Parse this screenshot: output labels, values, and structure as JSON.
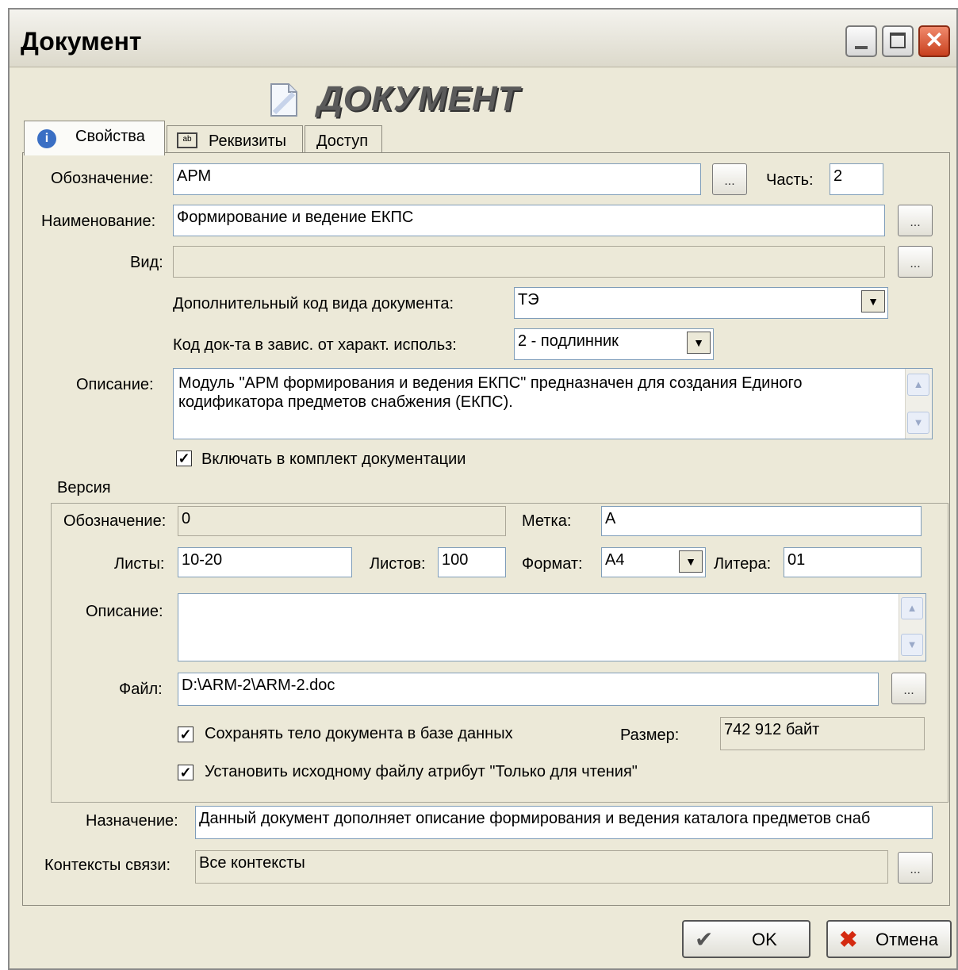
{
  "window": {
    "title": "Документ",
    "header_title": "ДОКУМЕНТ"
  },
  "tabs": [
    {
      "label": "Свойства",
      "icon": "info-icon"
    },
    {
      "label": "Реквизиты",
      "icon": "fields-icon"
    },
    {
      "label": "Доступ"
    }
  ],
  "props": {
    "designation_label": "Обозначение:",
    "designation_value": "АРМ",
    "part_label": "Часть:",
    "part_value": "2",
    "name_label": "Наименование:",
    "name_value": "Формирование и ведение ЕКПС",
    "kind_label": "Вид:",
    "kind_value": "",
    "extra_code_label": "Дополнительный код вида документа:",
    "extra_code_value": "ТЭ",
    "usage_code_label": "Код док-та в завис. от характ. использ:",
    "usage_code_value": "2 - подлинник",
    "description_label": "Описание:",
    "description_value": "Модуль \"АРМ формирования и ведения ЕКПС\" предназначен для создания Единого кодификатора предметов снабжения (ЕКПС).",
    "include_label": "Включать в комплект документации",
    "include_checked": true
  },
  "version": {
    "group_label": "Версия",
    "designation_label": "Обозначение:",
    "designation_value": "0",
    "mark_label": "Метка:",
    "mark_value": "А",
    "sheets_label": "Листы:",
    "sheets_value": "10-20",
    "sheets_count_label": "Листов:",
    "sheets_count_value": "100",
    "format_label": "Формат:",
    "format_value": "А4",
    "litera_label": "Литера:",
    "litera_value": "01",
    "description_label": "Описание:",
    "description_value": "",
    "file_label": "Файл:",
    "file_value": "D:\\ARM-2\\ARM-2.doc",
    "save_body_label": "Сохранять тело документа в базе данных",
    "save_body_checked": true,
    "size_label": "Размер:",
    "size_value": "742 912 байт",
    "readonly_label": "Установить исходному файлу атрибут \"Только для чтения\"",
    "readonly_checked": true
  },
  "purpose": {
    "label": "Назначение:",
    "value": "Данный документ дополняет описание формирования и ведения каталога предметов снаб"
  },
  "contexts": {
    "label": "Контексты связи:",
    "value": "Все контексты"
  },
  "buttons": {
    "ok": "OK",
    "cancel": "Отмена",
    "browse": "..."
  },
  "colors": {
    "accent_border": "#7f9db9",
    "close_button": "#c8401e"
  }
}
